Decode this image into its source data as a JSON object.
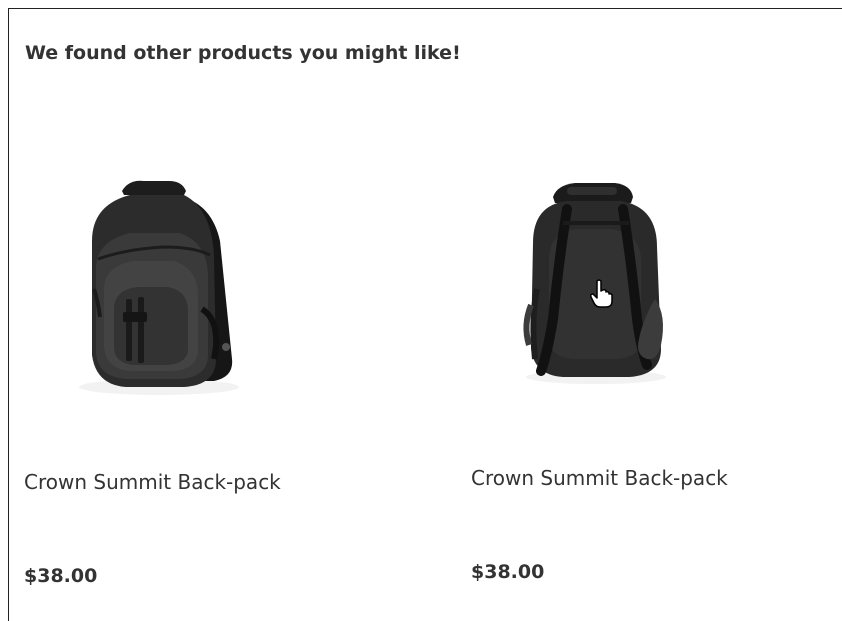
{
  "section": {
    "heading": "We found other products you might like!"
  },
  "products": [
    {
      "name": "Crown Summit Back-pack",
      "price": "$38.00",
      "image_icon": "backpack-front-image"
    },
    {
      "name": "Crown Summit Back-pack",
      "price": "$38.00",
      "image_icon": "backpack-back-image"
    }
  ],
  "cursor": {
    "icon": "hand-pointer-icon"
  },
  "colors": {
    "text": "#333333",
    "border": "#222222",
    "bag_dark": "#202020",
    "bag_mid": "#3a3a3a",
    "bag_light": "#555555"
  }
}
